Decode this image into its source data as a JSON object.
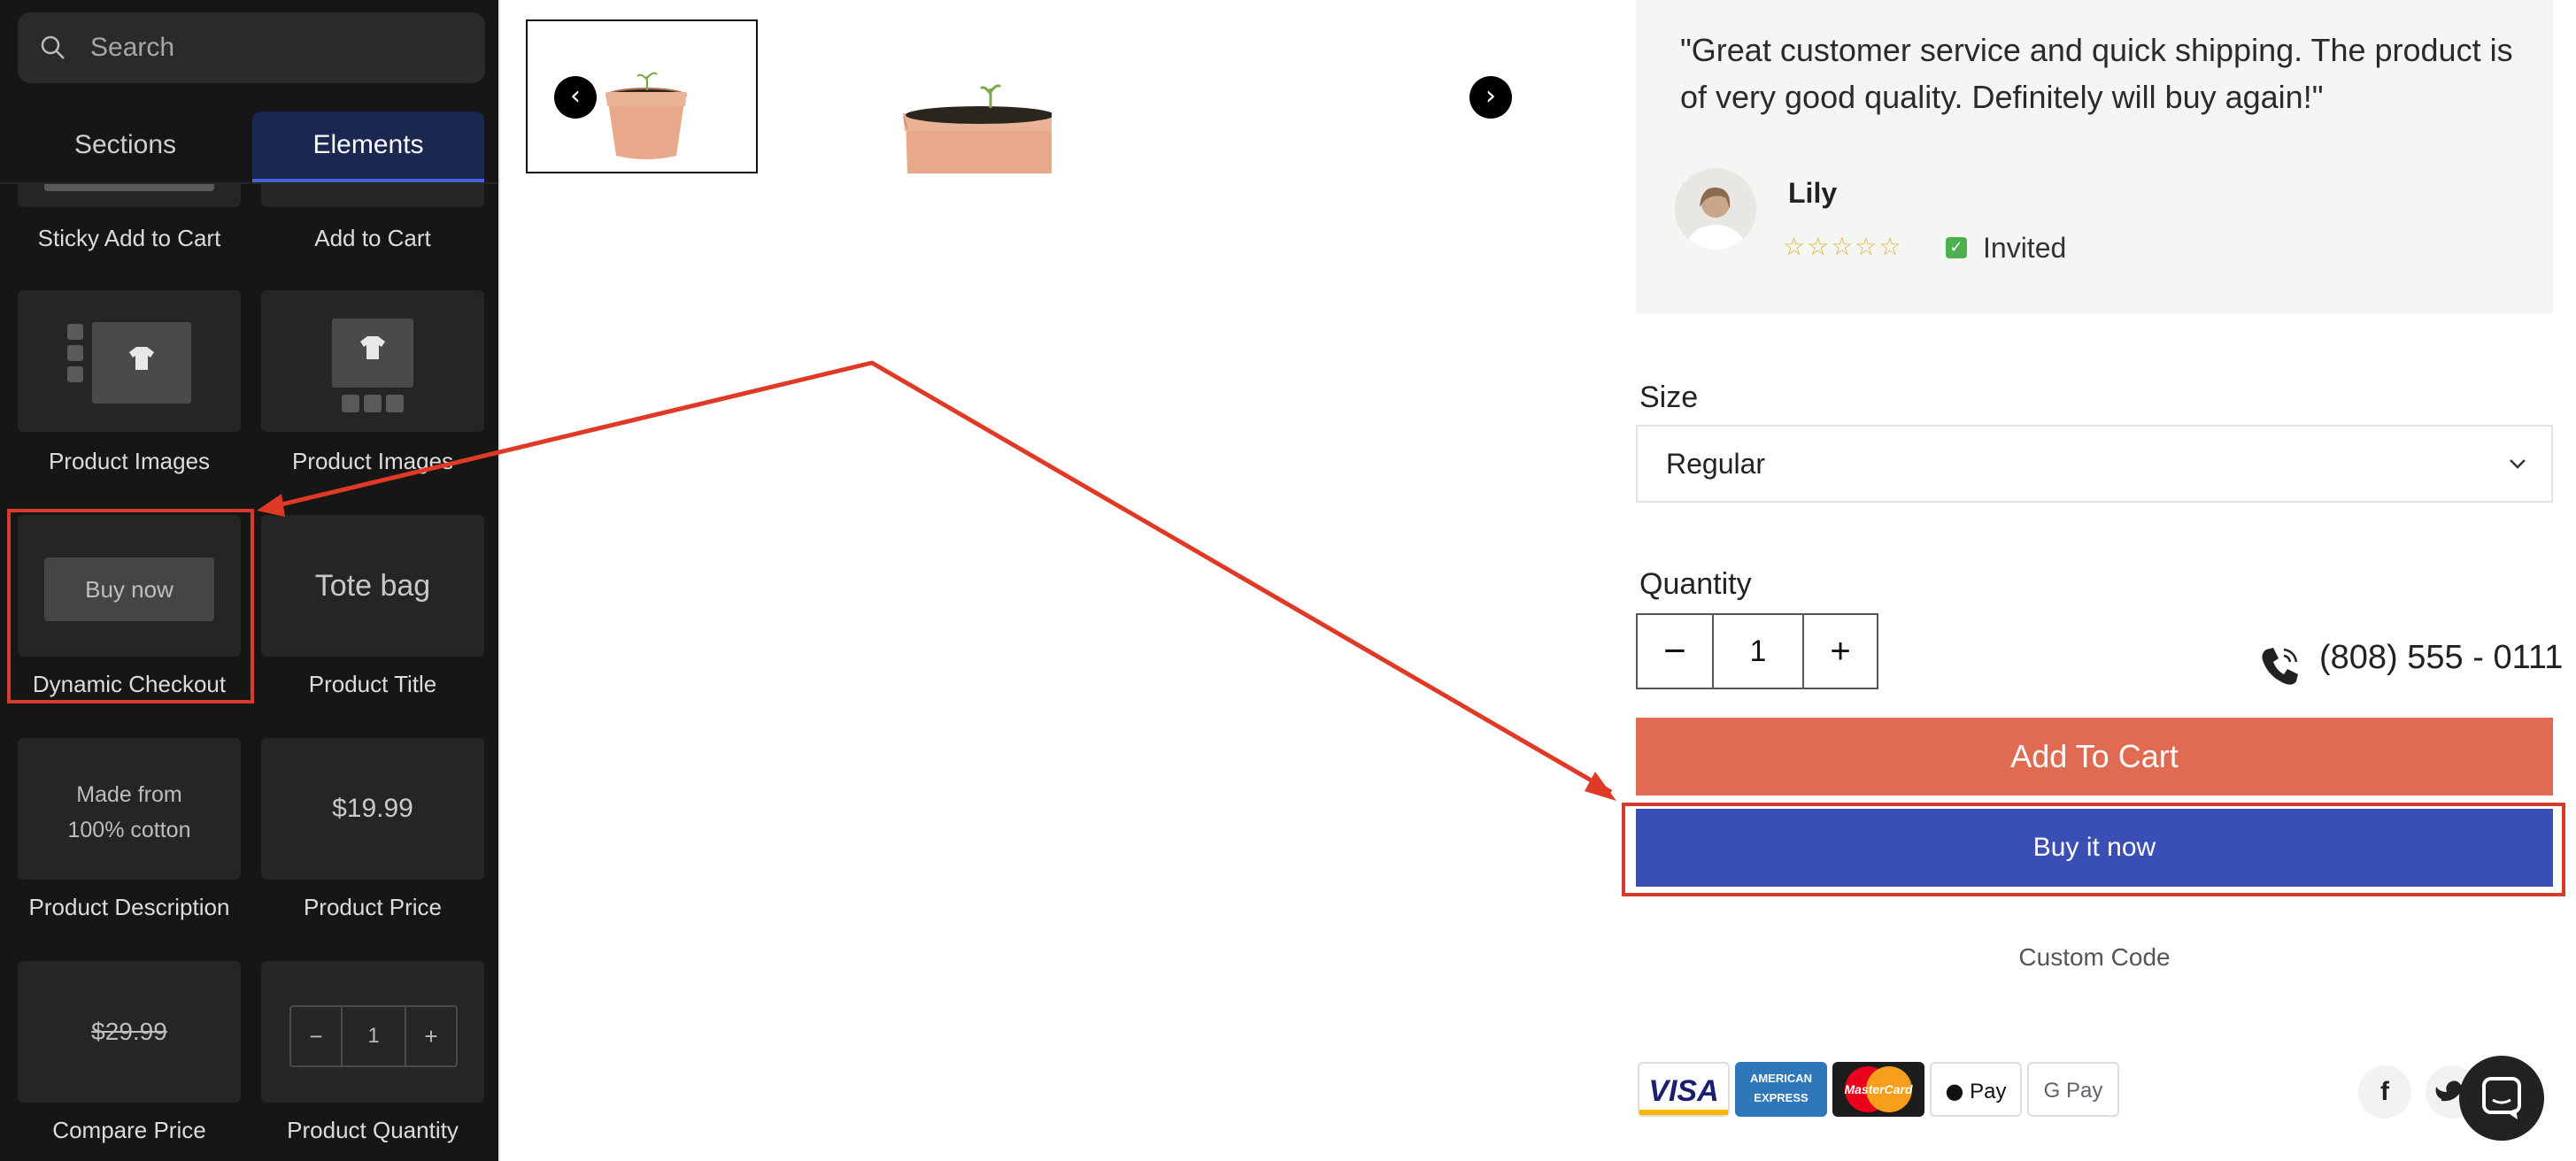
{
  "panel": {
    "search_placeholder": "Search",
    "tabs": {
      "sections": "Sections",
      "elements": "Elements"
    },
    "elements": {
      "sticky_add_to_cart": "Sticky Add to Cart",
      "add_to_cart": "Add to Cart",
      "product_images_1": "Product Images",
      "product_images_2": "Product Images",
      "dynamic_checkout": "Dynamic Checkout",
      "dynamic_checkout_preview": "Buy now",
      "product_title": "Product Title",
      "product_title_preview": "Tote bag",
      "product_description": "Product Description",
      "product_description_preview_1": "Made from",
      "product_description_preview_2": "100% cotton",
      "product_price": "Product Price",
      "product_price_preview": "$19.99",
      "compare_price": "Compare Price",
      "compare_price_preview": "$29.99",
      "product_quantity": "Product Quantity",
      "product_quantity_preview": "1"
    }
  },
  "review": {
    "quote": "\"Great customer service and quick shipping. The product is of very good quality. Definitely will buy again!\"",
    "name": "Lily",
    "stars": "☆☆☆☆☆",
    "badge": "Invited"
  },
  "product": {
    "size_label": "Size",
    "size_value": "Regular",
    "quantity_label": "Quantity",
    "quantity_value": "1",
    "phone": "(808) 555 - 0111",
    "add_to_cart": "Add To Cart",
    "buy_now": "Buy it now",
    "custom_code": "Custom Code"
  },
  "payments": {
    "visa": "VISA",
    "amex": "AMERICAN EXPRESS",
    "mastercard": "MasterCard",
    "applepay": "Pay",
    "googlepay": "G Pay"
  },
  "social": {
    "facebook": "f"
  },
  "colors": {
    "accent_blue": "#3a4fb5",
    "add_to_cart": "#e06b52",
    "highlight_red": "#d93a2b",
    "panel_bg": "#161616"
  }
}
